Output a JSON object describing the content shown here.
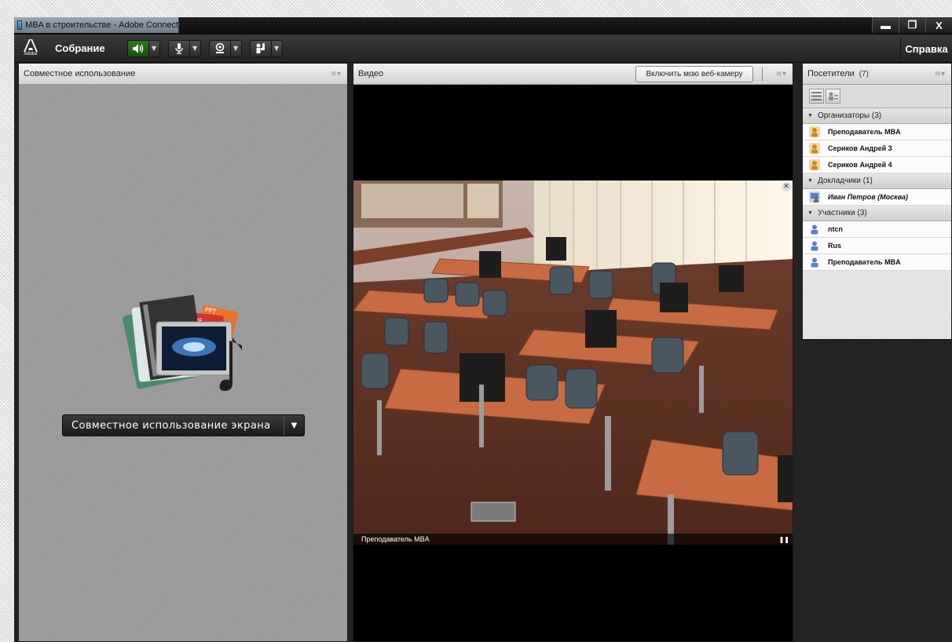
{
  "window": {
    "title": "MBA в строительстве - Adobe Connect",
    "controls": {
      "minimize": "▬",
      "restore": "❐",
      "close": "X"
    }
  },
  "toolbar": {
    "logo_text": "Adobe",
    "meeting_menu": "Собрание",
    "help": "Справка",
    "buttons": [
      {
        "icon": "speaker-icon",
        "active": true
      },
      {
        "icon": "microphone-icon",
        "active": false
      },
      {
        "icon": "webcam-icon",
        "active": false
      },
      {
        "icon": "raise-hand-icon",
        "active": false
      }
    ]
  },
  "share_pod": {
    "title": "Совместное использование",
    "art_labels": {
      "ppt": "PPT",
      "pdf": "PDF"
    },
    "share_button": "Совместное использование экрана"
  },
  "video_pod": {
    "title": "Видео",
    "start_webcam_button": "Включить мою веб-камеру",
    "feed_caption": "Преподаватель MBA"
  },
  "attendees_pod": {
    "title": "Посетители",
    "count": "(7)",
    "sections": [
      {
        "label": "Организаторы (3)",
        "role": "host",
        "people": [
          "Преподаватель MBA",
          "Сериков Андрей 3",
          "Сериков Андрей 4"
        ]
      },
      {
        "label": "Докладчики (1)",
        "role": "presenter",
        "people": [
          "Иван Петров (Москва)"
        ]
      },
      {
        "label": "Участники (3)",
        "role": "participant",
        "people": [
          "ntcn",
          "Rus",
          "Преподаватель MBA"
        ]
      }
    ]
  },
  "colors": {
    "speaker_active": "#2c7a1f",
    "host_icon": "#c98b1f",
    "participant_icon": "#5a7fbf"
  }
}
